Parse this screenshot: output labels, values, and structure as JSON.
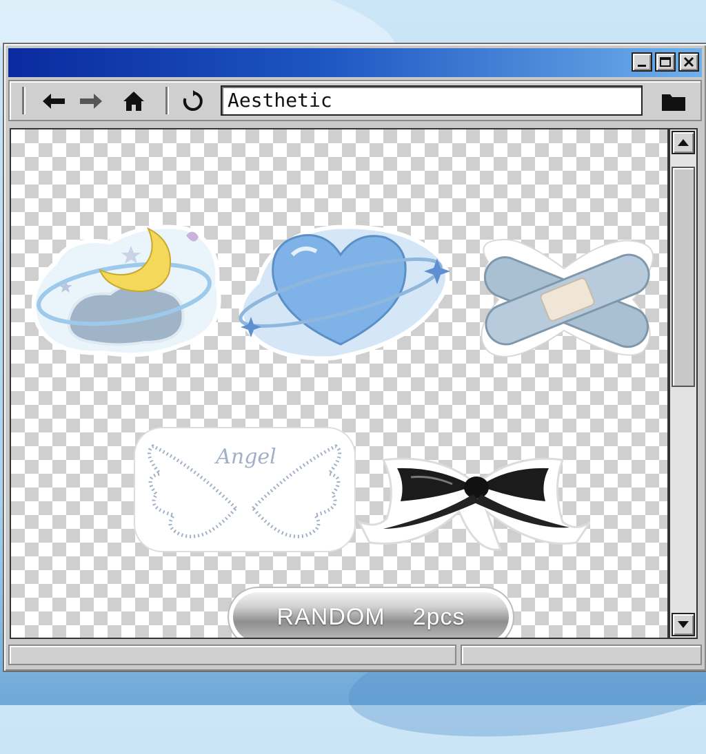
{
  "window": {
    "address_value": "Aesthetic",
    "title_color_start": "#0a2aa0",
    "title_color_end": "#6fb0ea"
  },
  "icons": {
    "back": "arrow-left-icon",
    "forward": "arrow-right-icon",
    "home": "home-icon",
    "refresh": "refresh-icon",
    "folder": "folder-icon",
    "minimize": "minimize-icon",
    "maximize": "maximize-icon",
    "close": "close-icon"
  },
  "stickers": {
    "angel_text": "Angel",
    "badge_left": "RANDOM",
    "badge_right": "2pcs"
  }
}
